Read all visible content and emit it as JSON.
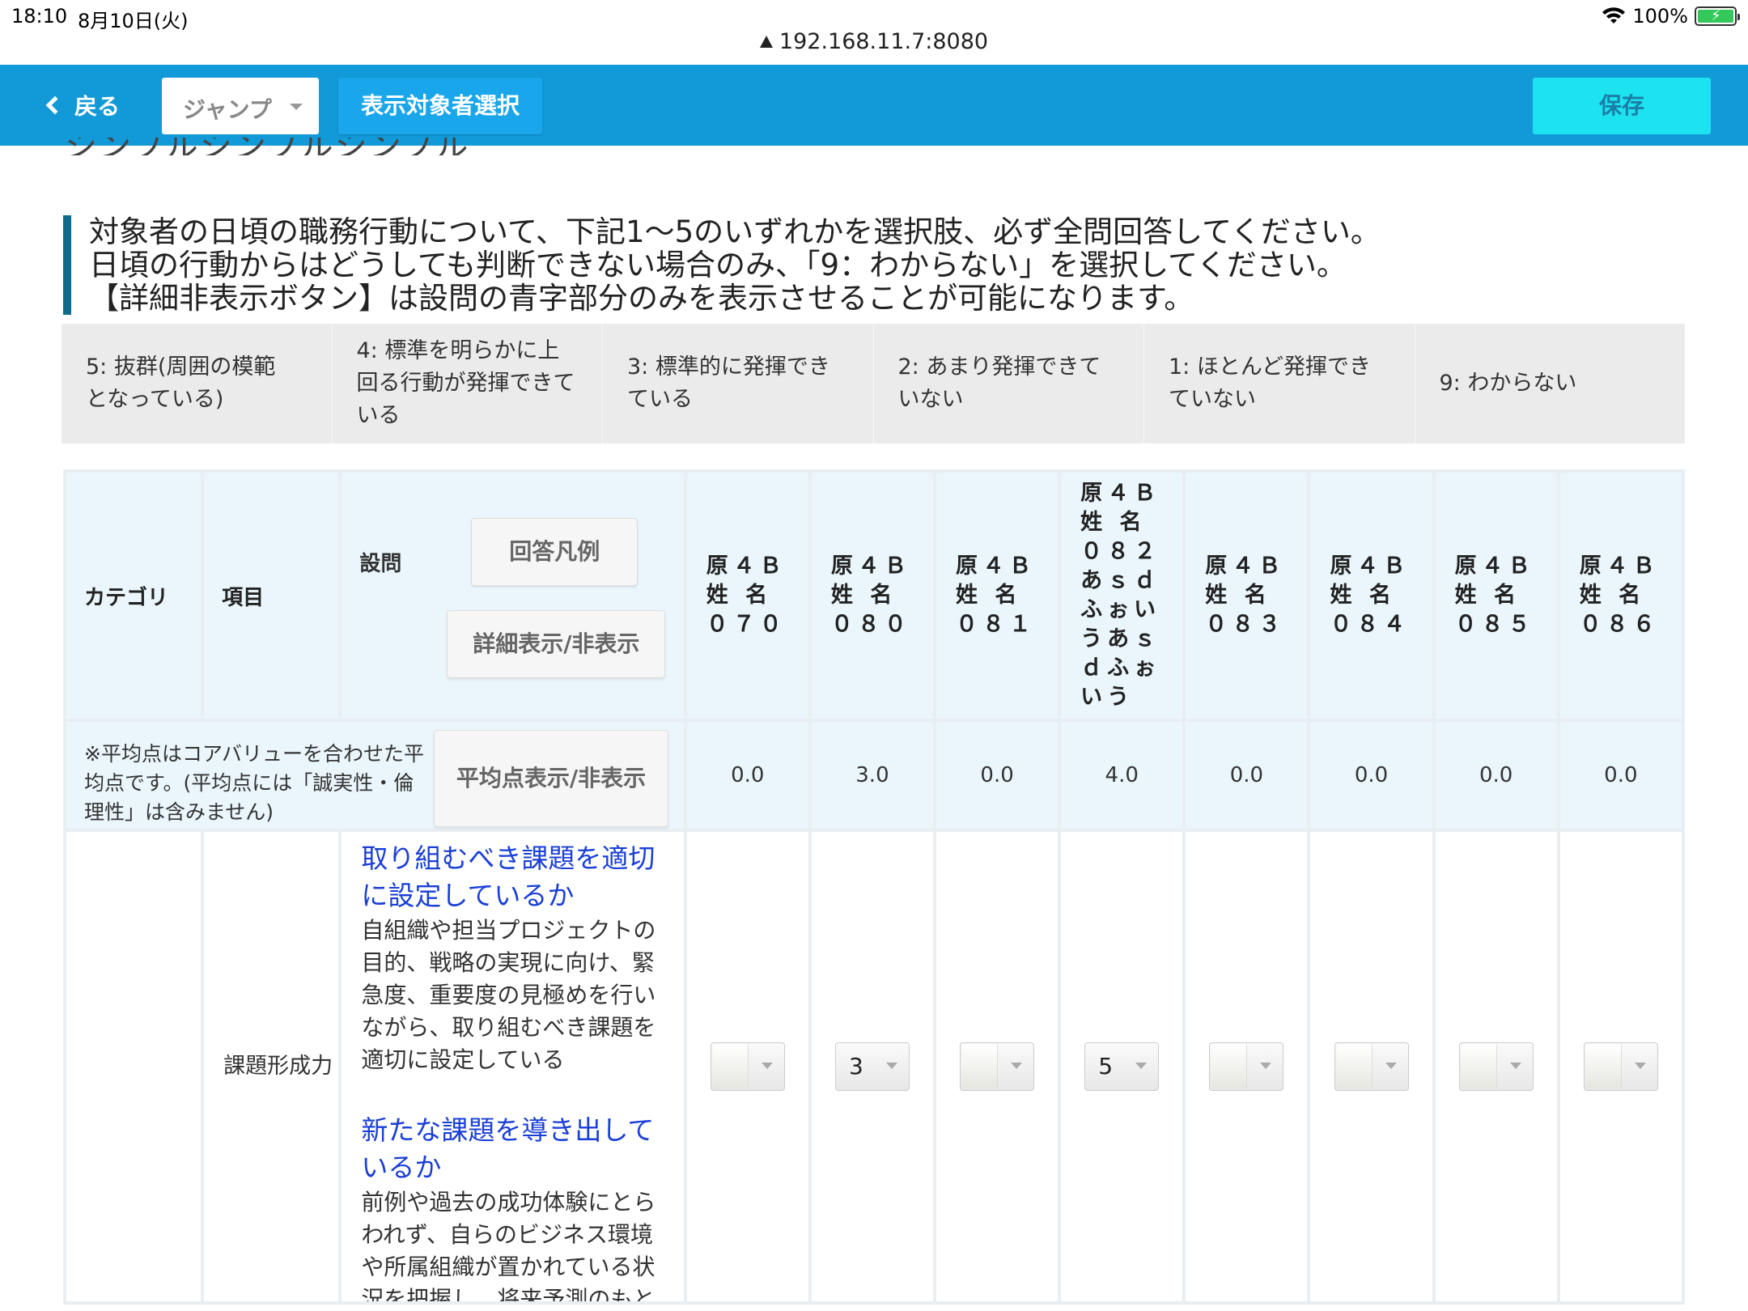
{
  "status_bar": {
    "time": "18:10",
    "date": "8月10日(火)",
    "battery": "100%"
  },
  "url": "192.168.11.7:8080",
  "nav": {
    "back_label": "戻る",
    "jump_label": "ジャンプ",
    "select_target_label": "表示対象者選択",
    "save_label": "保存",
    "accent_color": "#1199d8",
    "save_color": "#1de3f0"
  },
  "page_title_partial": "シンプルシンプルシンプル",
  "instructions": [
    "対象者の日頃の職務行動について、下記1〜5のいずれかを選択肢、必ず全問回答してください。",
    "日頃の行動からはどうしても判断できない場合のみ、「9：わからない」を選択してください。",
    "【詳細非表示ボタン】は設問の青字部分のみを表示させることが可能になります。"
  ],
  "legend": [
    "5: 抜群(周囲の模範となっている)",
    "4: 標準を明らかに上回る行動が発揮できている",
    "3: 標準的に発揮できている",
    "2: あまり発揮できていない",
    "1: ほとんど発揮できていない",
    "9: わからない"
  ],
  "table": {
    "headers": {
      "category": "カテゴリ",
      "item": "項目",
      "question": "設問",
      "answer_legend_button": "回答凡例",
      "detail_toggle_button": "詳細表示/非表示"
    },
    "avg_note": "※平均点はコアバリューを合わせた平均点です。(平均点には「誠実性・倫理性」は含みません)",
    "avg_toggle_button": "平均点表示/非表示",
    "persons": [
      {
        "name": "原４Ｂ 姓 名 ０７０",
        "avg": "0.0",
        "answer": ""
      },
      {
        "name": "原４Ｂ 姓 名 ０８０",
        "avg": "3.0",
        "answer": "3"
      },
      {
        "name": "原４Ｂ 姓 名 ０８１",
        "avg": "0.0",
        "answer": ""
      },
      {
        "name": "原４Ｂ 姓 名 ０８２ あｓｄふぉいうあｓｄふぉいう",
        "avg": "4.0",
        "answer": "5"
      },
      {
        "name": "原４Ｂ 姓 名 ０８３",
        "avg": "0.0",
        "answer": ""
      },
      {
        "name": "原４Ｂ 姓 名 ０８４",
        "avg": "0.0",
        "answer": ""
      },
      {
        "name": "原４Ｂ 姓 名 ０８５",
        "avg": "0.0",
        "answer": ""
      },
      {
        "name": "原４Ｂ 姓 名 ０８６",
        "avg": "0.0",
        "answer": ""
      }
    ],
    "row": {
      "category": "",
      "item": "課題形成力",
      "questions": [
        {
          "title": "取り組むべき課題を適切に設定しているか",
          "desc": "自組織や担当プロジェクトの目的、戦略の実現に向け、緊急度、重要度の見極めを行いながら、取り組むべき課題を適切に設定している"
        },
        {
          "title": "新たな課題を導き出しているか",
          "desc": "前例や過去の成功体験にとらわれず、自らのビジネス環境や所属組織が置かれている状況を把握し、将来予測のもと"
        }
      ]
    }
  }
}
